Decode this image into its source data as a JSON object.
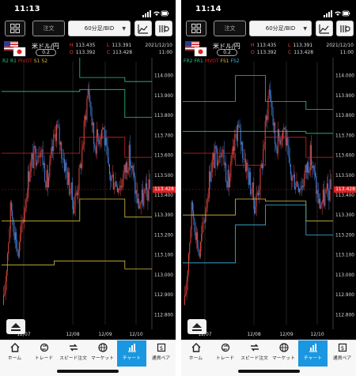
{
  "screens": [
    {
      "id": "left",
      "time": "11:13",
      "toolbar": {
        "order_label": "注文",
        "timeframe": "60分足/BID"
      },
      "pair": "米ドル/円",
      "lot": "0.2",
      "ohlc": {
        "h": "113.435",
        "l": "113.391",
        "o": "113.392",
        "c": "113.428"
      },
      "date": "2021/12/10",
      "clock": "11:00",
      "legend": [
        {
          "label": "R2",
          "color": "#2ec27e"
        },
        {
          "label": "R1",
          "color": "#2ec27e"
        },
        {
          "label": "PIVOT",
          "color": "#e02020"
        },
        {
          "label": "S1",
          "color": "#d8c040"
        },
        {
          "label": "S2",
          "color": "#d8c040"
        }
      ],
      "current_price": "113.428",
      "price_axis": [
        "114.000",
        "113.900",
        "113.800",
        "113.700",
        "113.600",
        "113.500",
        "113.400",
        "113.300",
        "113.200",
        "113.100",
        "113.000",
        "112.900",
        "112.800"
      ],
      "date_axis": [
        "12/07",
        "12/08",
        "12/09",
        "12/10"
      ],
      "levels": [
        {
          "name": "R2",
          "color": "#2ec27e",
          "steps": [
            [
              0,
              0.52,
              114.25
            ],
            [
              0.52,
              0.82,
              113.99
            ],
            [
              0.82,
              1,
              113.97
            ]
          ]
        },
        {
          "name": "R1",
          "color": "#2ec27e",
          "steps": [
            [
              0,
              0.52,
              113.92
            ],
            [
              0.52,
              0.82,
              113.93
            ],
            [
              0.82,
              1,
              113.79
            ]
          ]
        },
        {
          "name": "PIVOT",
          "color": "#e02020",
          "steps": [
            [
              0,
              0.52,
              113.61
            ],
            [
              0.52,
              0.82,
              113.69
            ],
            [
              0.82,
              1,
              113.59
            ]
          ]
        },
        {
          "name": "S1",
          "color": "#d8c040",
          "steps": [
            [
              0,
              0.52,
              113.27
            ],
            [
              0.52,
              0.82,
              113.38
            ],
            [
              0.82,
              1,
              113.29
            ]
          ]
        },
        {
          "name": "S2",
          "color": "#d8c040",
          "steps": [
            [
              0,
              0.35,
              113.05
            ],
            [
              0.35,
              0.82,
              113.07
            ],
            [
              0.82,
              1,
              113.03
            ]
          ]
        }
      ]
    },
    {
      "id": "right",
      "time": "11:14",
      "toolbar": {
        "order_label": "注文",
        "timeframe": "60分足/BID"
      },
      "pair": "米ドル/円",
      "lot": "0.2",
      "ohlc": {
        "h": "113.435",
        "l": "113.391",
        "o": "113.392",
        "c": "113.428"
      },
      "date": "2021/12/10",
      "clock": "11:00",
      "legend": [
        {
          "label": "FR2",
          "color": "#2ec27e"
        },
        {
          "label": "FR1",
          "color": "#2ec27e"
        },
        {
          "label": "PIVOT",
          "color": "#e02020"
        },
        {
          "label": "FS1",
          "color": "#d8c040"
        },
        {
          "label": "FS2",
          "color": "#40b8e0"
        }
      ],
      "current_price": "113.428",
      "price_axis": [
        "114.000",
        "113.900",
        "113.800",
        "113.700",
        "113.600",
        "113.500",
        "113.400",
        "113.300",
        "113.200",
        "113.100",
        "113.000",
        "112.900",
        "112.800"
      ],
      "date_axis": [
        "12/07",
        "12/08",
        "12/09",
        "12/10"
      ],
      "levels": [
        {
          "name": "FR2",
          "color": "#2ec27e",
          "steps": [
            [
              0,
              0.35,
              113.87
            ],
            [
              0.35,
              0.55,
              114.0
            ],
            [
              0.55,
              0.82,
              113.87
            ],
            [
              0.82,
              1,
              113.83
            ]
          ]
        },
        {
          "name": "FR1",
          "color": "#2ec27e",
          "steps": [
            [
              0,
              0.35,
              113.72
            ],
            [
              0.35,
              0.55,
              113.72
            ],
            [
              0.55,
              0.82,
              113.72
            ],
            [
              0.82,
              1,
              113.71
            ]
          ]
        },
        {
          "name": "PIVOT",
          "color": "#e02020",
          "steps": [
            [
              0,
              0.35,
              113.61
            ],
            [
              0.35,
              0.55,
              113.55
            ],
            [
              0.55,
              0.82,
              113.69
            ],
            [
              0.82,
              1,
              113.59
            ]
          ]
        },
        {
          "name": "FS1",
          "color": "#d8c040",
          "steps": [
            [
              0,
              0.35,
              113.3
            ],
            [
              0.35,
              0.55,
              113.38
            ],
            [
              0.55,
              0.82,
              113.37
            ],
            [
              0.82,
              1,
              113.27
            ]
          ]
        },
        {
          "name": "FS2",
          "color": "#40b8e0",
          "steps": [
            [
              0,
              0.35,
              113.06
            ],
            [
              0.35,
              0.55,
              113.25
            ],
            [
              0.55,
              0.82,
              113.35
            ],
            [
              0.82,
              1,
              113.2
            ]
          ]
        }
      ]
    }
  ],
  "nav": [
    {
      "label": "ホーム",
      "icon": "home-icon"
    },
    {
      "label": "トレード",
      "icon": "trade-icon"
    },
    {
      "label": "スピード注文",
      "icon": "speed-order-icon"
    },
    {
      "label": "マーケット",
      "icon": "globe-icon"
    },
    {
      "label": "チャート",
      "icon": "chart-icon",
      "active": true
    },
    {
      "label": "通貨ペア",
      "icon": "currency-pair-icon"
    }
  ],
  "colors": {
    "up": "#e0453f",
    "down": "#3f7fd8",
    "price_tag": "#e32020",
    "active_tab": "#1b96e0"
  }
}
